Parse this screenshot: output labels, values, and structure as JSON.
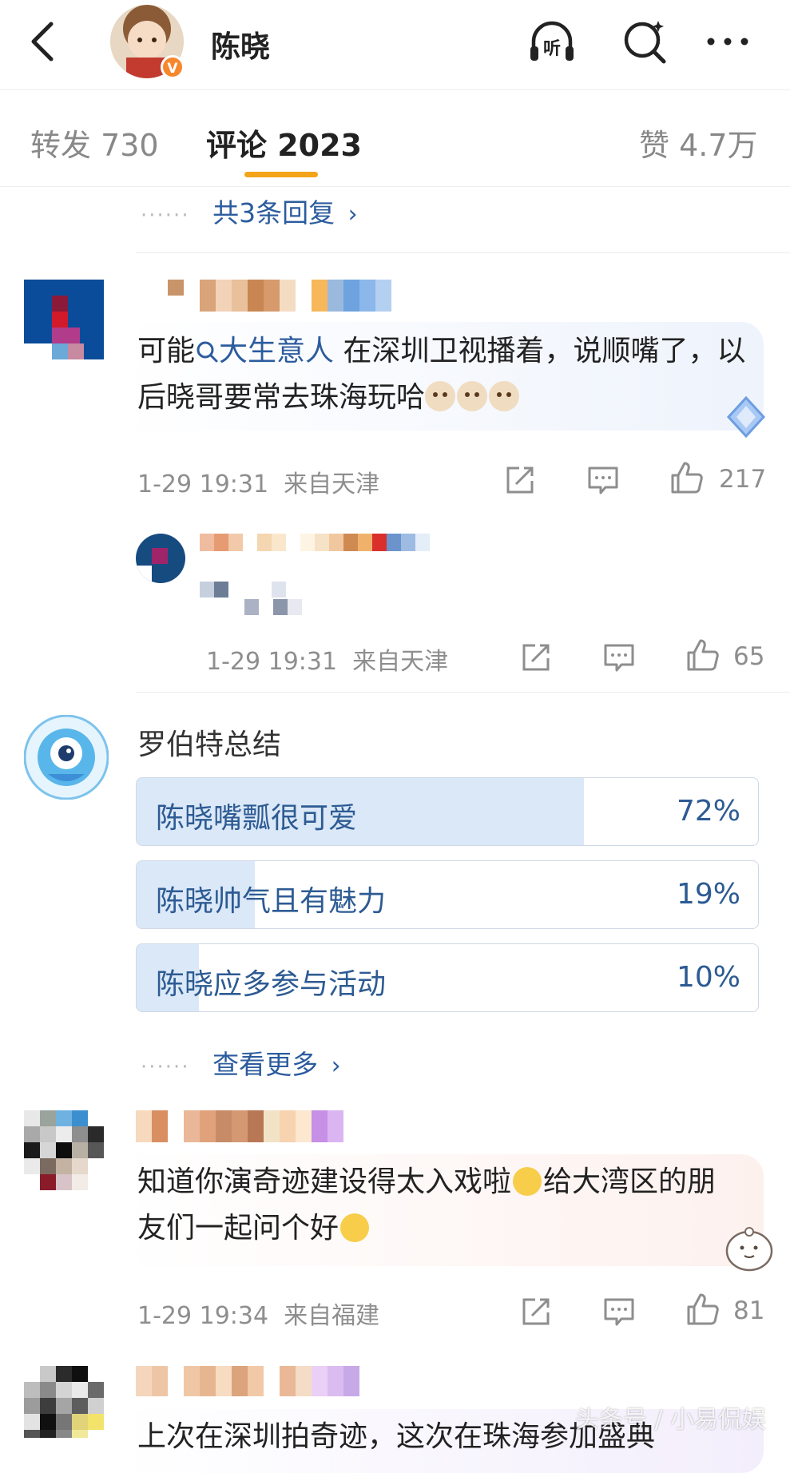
{
  "header": {
    "title": "陈晓",
    "verified_badge": "V",
    "listen_label": "听",
    "icons": [
      "back-icon",
      "listen-icon",
      "search-icon",
      "more-icon"
    ]
  },
  "tabs": [
    {
      "label": "转发 730"
    },
    {
      "label": "评论 2023"
    },
    {
      "label": "赞 4.7万"
    }
  ],
  "comments": [
    {
      "more_replies": "共3条回复",
      "text_pre": "可能",
      "topic": "大生意人",
      "text_post": " 在深圳卫视播着，说顺嘴了，以后晓哥要常去珠海玩哈",
      "time": "1-29 19:31",
      "location": "来自天津",
      "likes": "217",
      "reply": {
        "time": "1-29 19:31",
        "location": "来自天津",
        "likes": "65"
      }
    }
  ],
  "summary": {
    "author": "罗伯特总结",
    "options": [
      {
        "label": "陈晓嘴瓢很可爱",
        "pct": "72%",
        "value": 72
      },
      {
        "label": "陈晓帅气且有魅力",
        "pct": "19%",
        "value": 19
      },
      {
        "label": "陈晓应多参与活动",
        "pct": "10%",
        "value": 10
      }
    ],
    "see_more": "查看更多"
  },
  "comment2": {
    "text_a": "知道你演奇迹建设得太入戏啦",
    "text_b": "给大湾区的朋友们一起问个好",
    "time": "1-29 19:34",
    "location": "来自福建",
    "likes": "81"
  },
  "comment3": {
    "partial_text": "上次在深圳拍奇迹，这次在珠海参加盛典"
  },
  "watermark": "头条号 / 小易侃娱",
  "colors": {
    "accent": "#f3a418",
    "link": "#2c5c9e",
    "poll_fill": "#dbe8f7"
  }
}
